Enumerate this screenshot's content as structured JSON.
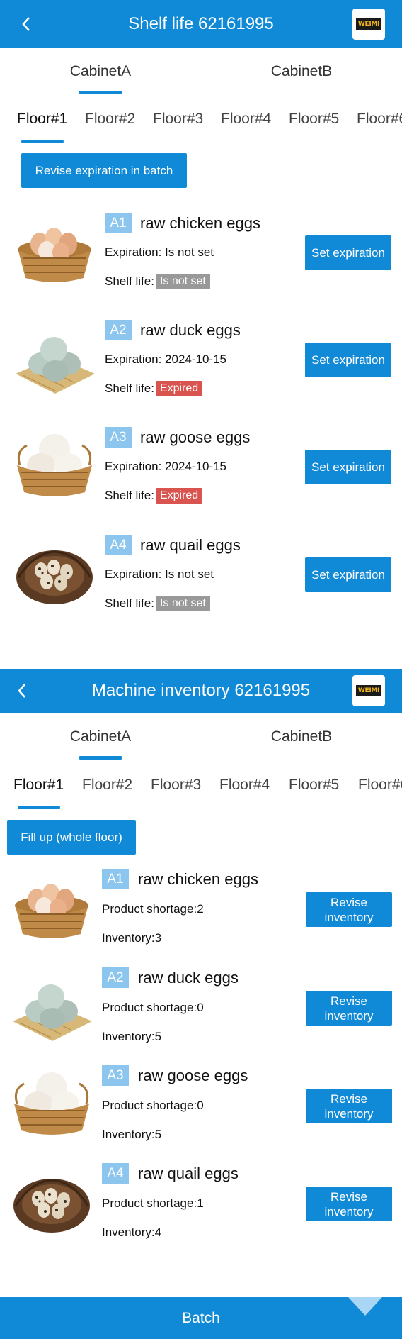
{
  "screen1": {
    "header": {
      "title": "Shelf life 62161995",
      "logo_text": "WEIMI"
    },
    "cabinet_tabs": [
      {
        "label": "CabinetA",
        "active": true
      },
      {
        "label": "CabinetB",
        "active": false
      }
    ],
    "floor_tabs": [
      {
        "label": "Floor#1",
        "active": true
      },
      {
        "label": "Floor#2"
      },
      {
        "label": "Floor#3"
      },
      {
        "label": "Floor#4"
      },
      {
        "label": "Floor#5"
      },
      {
        "label": "Floor#6"
      }
    ],
    "batch_button": "Revise expiration in batch",
    "items": [
      {
        "code": "A1",
        "name": "raw chicken eggs",
        "expiration": "Expiration: Is not set",
        "shelf_label": "Shelf life:",
        "shelf_status": "Is not set",
        "action": "Set expiration"
      },
      {
        "code": "A2",
        "name": "raw duck eggs",
        "expiration": "Expiration: 2024-10-15",
        "shelf_label": "Shelf life:",
        "shelf_status": "Expired",
        "action": "Set expiration"
      },
      {
        "code": "A3",
        "name": "raw goose eggs",
        "expiration": "Expiration: 2024-10-15",
        "shelf_label": "Shelf life:",
        "shelf_status": "Expired",
        "action": "Set expiration"
      },
      {
        "code": "A4",
        "name": "raw quail eggs",
        "expiration": "Expiration: Is not set",
        "shelf_label": "Shelf life:",
        "shelf_status": "Is not set",
        "action": "Set expiration"
      }
    ]
  },
  "screen2": {
    "header": {
      "title": "Machine inventory 62161995",
      "logo_text": "WEIMI"
    },
    "cabinet_tabs": [
      {
        "label": "CabinetA",
        "active": true
      },
      {
        "label": "CabinetB",
        "active": false
      }
    ],
    "floor_tabs": [
      {
        "label": "Floor#1",
        "active": true
      },
      {
        "label": "Floor#2"
      },
      {
        "label": "Floor#3"
      },
      {
        "label": "Floor#4"
      },
      {
        "label": "Floor#5"
      },
      {
        "label": "Floor#6"
      }
    ],
    "fill_button": "Fill up (whole floor)",
    "items": [
      {
        "code": "A1",
        "name": "raw chicken eggs",
        "shortage": "Product shortage:2",
        "inventory": "Inventory:3",
        "action": "Revise inventory"
      },
      {
        "code": "A2",
        "name": "raw duck eggs",
        "shortage": "Product shortage:0",
        "inventory": "Inventory:5",
        "action": "Revise inventory"
      },
      {
        "code": "A3",
        "name": "raw goose eggs",
        "shortage": "Product shortage:0",
        "inventory": "Inventory:5",
        "action": "Revise inventory"
      },
      {
        "code": "A4",
        "name": "raw quail eggs",
        "shortage": "Product shortage:1",
        "inventory": "Inventory:4",
        "action": "Revise inventory"
      }
    ],
    "bottom_bar": "Batch"
  },
  "colors": {
    "primary": "#1089d6",
    "code_badge": "#8cc6ee",
    "status_grey": "#999999",
    "status_red": "#d9534f"
  },
  "icons": {
    "back": "chevron-left-icon",
    "logo": "weimi-logo"
  }
}
